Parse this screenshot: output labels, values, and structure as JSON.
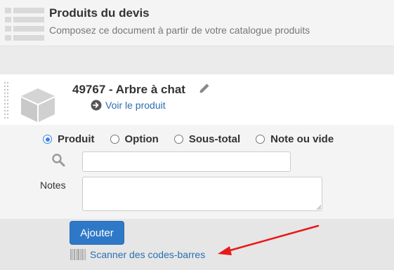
{
  "header": {
    "title": "Produits du devis",
    "subtitle": "Composez ce document à partir de votre catalogue produits",
    "icon": "list-icon"
  },
  "product": {
    "title": "49767 - Arbre à chat",
    "view_link": "Voir le produit",
    "icon": "box-icon"
  },
  "form": {
    "radios": [
      {
        "label": "Produit",
        "checked": true
      },
      {
        "label": "Option",
        "checked": false
      },
      {
        "label": "Sous-total",
        "checked": false
      },
      {
        "label": "Note ou vide",
        "checked": false
      }
    ],
    "search_value": "",
    "notes_label": "Notes",
    "notes_value": ""
  },
  "footer": {
    "add_button": "Ajouter",
    "scan_link": "Scanner des codes-barres"
  },
  "colors": {
    "link": "#2a6fb2",
    "button": "#2e78c7",
    "annotation_arrow": "#e8191a"
  }
}
